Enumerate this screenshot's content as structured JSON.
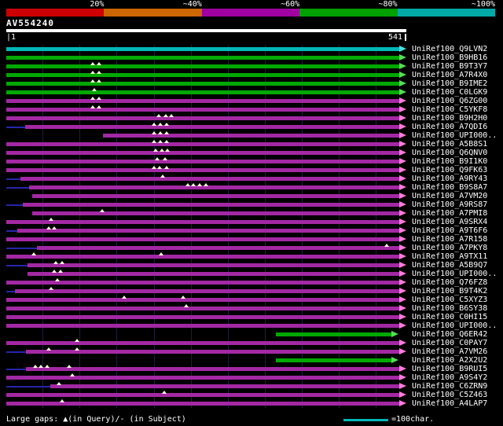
{
  "chart_data": {
    "type": "bar",
    "title": "AV554240",
    "x_range": [
      1,
      541
    ],
    "x_tick_labels": [
      "|1",
      "541"
    ],
    "grid_interval": 50,
    "identity_scale": {
      "labels": [
        "20%",
        "~40%",
        "~60%",
        "~80%",
        "~100%"
      ],
      "colors": [
        "#cc0000",
        "#cc6600",
        "#a000a0",
        "#00a000",
        "#00a8a8"
      ]
    },
    "legend": {
      "gaps": "Large gaps: ▲(in Query)/- (in Subject)",
      "scale_line": "=100char."
    },
    "rows": [
      {
        "label": "UniRef100_Q9LVN2",
        "color": "cyan",
        "start": 1,
        "end": 541,
        "gaps": []
      },
      {
        "label": "UniRef100_B9HB16",
        "color": "green",
        "start": 1,
        "end": 541,
        "gaps": []
      },
      {
        "label": "UniRef100_B9T3Y7",
        "color": "green",
        "start": 1,
        "end": 541,
        "gaps": [
          118,
          126
        ]
      },
      {
        "label": "UniRef100_A7R4X0",
        "color": "green",
        "start": 1,
        "end": 541,
        "gaps": [
          118,
          126
        ]
      },
      {
        "label": "UniRef100_B9IME2",
        "color": "green",
        "start": 1,
        "end": 541,
        "gaps": [
          118,
          126
        ]
      },
      {
        "label": "UniRef100_C0LGK9",
        "color": "green",
        "start": 1,
        "end": 541,
        "gaps": [
          120
        ]
      },
      {
        "label": "UniRef100_Q6ZG00",
        "color": "purple",
        "start": 1,
        "end": 541,
        "gaps": [
          118,
          126
        ]
      },
      {
        "label": "UniRef100_C5YKF8",
        "color": "purple",
        "start": 1,
        "end": 541,
        "gaps": [
          118,
          126
        ]
      },
      {
        "label": "UniRef100_B9H2H0",
        "color": "purple",
        "start": 1,
        "end": 541,
        "gaps": [
          207,
          216,
          224
        ]
      },
      {
        "label": "UniRef100_A7QDI6",
        "color": "purple",
        "start": 26,
        "end": 541,
        "gaps": [
          200,
          209,
          217
        ],
        "line": [
          1,
          26
        ]
      },
      {
        "label": "UniRef100_UPI000..",
        "color": "purple",
        "start": 131,
        "end": 541,
        "gaps": [
          200,
          209,
          217
        ]
      },
      {
        "label": "UniRef100_A5B8S1",
        "color": "purple",
        "start": 1,
        "end": 541,
        "gaps": [
          200,
          209,
          217
        ]
      },
      {
        "label": "UniRef100_Q6QNV0",
        "color": "purple",
        "start": 1,
        "end": 541,
        "gaps": [
          203,
          211,
          219
        ]
      },
      {
        "label": "UniRef100_B9I1K0",
        "color": "purple",
        "start": 1,
        "end": 541,
        "gaps": [
          205,
          215
        ]
      },
      {
        "label": "UniRef100_Q9FK63",
        "color": "purple",
        "start": 1,
        "end": 541,
        "gaps": [
          200,
          208,
          217
        ]
      },
      {
        "label": "UniRef100_A9RY43",
        "color": "purple",
        "start": 20,
        "end": 541,
        "gaps": [
          212
        ],
        "line": [
          1,
          20
        ]
      },
      {
        "label": "UniRef100_B9S8A7",
        "color": "purple",
        "start": 32,
        "end": 541,
        "gaps": [
          246,
          254,
          262,
          270
        ],
        "line": [
          1,
          32
        ]
      },
      {
        "label": "UniRef100_A7VM20",
        "color": "purple",
        "start": 36,
        "end": 541,
        "gaps": []
      },
      {
        "label": "UniRef100_A9RS87",
        "color": "purple",
        "start": 23,
        "end": 541,
        "gaps": [],
        "line": [
          1,
          23
        ]
      },
      {
        "label": "UniRef100_A7PMI8",
        "color": "purple",
        "start": 36,
        "end": 541,
        "gaps": [
          130
        ]
      },
      {
        "label": "UniRef100_A9SRX4",
        "color": "purple",
        "start": 1,
        "end": 541,
        "gaps": [
          62
        ]
      },
      {
        "label": "UniRef100_A9T6F6",
        "color": "purple",
        "start": 16,
        "end": 541,
        "gaps": [
          58,
          66
        ],
        "line": [
          1,
          16
        ]
      },
      {
        "label": "UniRef100_A7R158",
        "color": "purple",
        "start": 1,
        "end": 541,
        "gaps": []
      },
      {
        "label": "UniRef100_A7PKY8",
        "color": "purple",
        "start": 42,
        "end": 541,
        "gaps": [
          514
        ],
        "line": [
          1,
          42
        ]
      },
      {
        "label": "UniRef100_A9TX11",
        "color": "purple",
        "start": 1,
        "end": 541,
        "gaps": [
          38,
          210
        ]
      },
      {
        "label": "UniRef100_A5B9Q7",
        "color": "purple",
        "start": 30,
        "end": 541,
        "gaps": [
          68,
          76
        ],
        "line": [
          1,
          30
        ]
      },
      {
        "label": "UniRef100_UPI000..",
        "color": "purple",
        "start": 30,
        "end": 541,
        "gaps": [
          66,
          74
        ]
      },
      {
        "label": "UniRef100_Q76FZ8",
        "color": "purple",
        "start": 1,
        "end": 541,
        "gaps": [
          70
        ]
      },
      {
        "label": "UniRef100_B9T4K2",
        "color": "purple",
        "start": 13,
        "end": 541,
        "gaps": [
          62
        ],
        "line": [
          1,
          13
        ]
      },
      {
        "label": "UniRef100_C5XYZ3",
        "color": "purple",
        "start": 1,
        "end": 541,
        "gaps": [
          160,
          240
        ]
      },
      {
        "label": "UniRef100_B6SY38",
        "color": "purple",
        "start": 1,
        "end": 541,
        "gaps": [
          244
        ]
      },
      {
        "label": "UniRef100_C0HI15",
        "color": "purple",
        "start": 1,
        "end": 541,
        "gaps": []
      },
      {
        "label": "UniRef100_UPI000..",
        "color": "purple",
        "start": 1,
        "end": 541,
        "gaps": []
      },
      {
        "label": "UniRef100_Q6ER42",
        "color": "green",
        "start": 365,
        "end": 530,
        "gaps": []
      },
      {
        "label": "UniRef100_C0PAY7",
        "color": "purple",
        "start": 1,
        "end": 541,
        "gaps": [
          96
        ]
      },
      {
        "label": "UniRef100_A7VM26",
        "color": "purple",
        "start": 27,
        "end": 541,
        "gaps": [
          58,
          96
        ],
        "line": [
          1,
          27
        ]
      },
      {
        "label": "UniRef100_A2X2U2",
        "color": "green",
        "start": 365,
        "end": 530,
        "gaps": []
      },
      {
        "label": "UniRef100_B9RUI5",
        "color": "purple",
        "start": 27,
        "end": 541,
        "gaps": [
          40,
          48,
          56,
          86
        ],
        "line": [
          1,
          27
        ]
      },
      {
        "label": "UniRef100_A9S4Y2",
        "color": "purple",
        "start": 1,
        "end": 541,
        "gaps": [
          90
        ]
      },
      {
        "label": "UniRef100_C6ZRN9",
        "color": "purple",
        "start": 60,
        "end": 541,
        "gaps": [
          72
        ],
        "line": [
          1,
          60
        ]
      },
      {
        "label": "UniRef100_C5Z463",
        "color": "purple",
        "start": 1,
        "end": 541,
        "gaps": [
          214
        ]
      },
      {
        "label": "UniRef100_A4LAP7",
        "color": "purple",
        "start": 1,
        "end": 541,
        "gaps": [
          76
        ]
      }
    ]
  },
  "colors": {
    "background": "#000000",
    "bar_cyan": "#00b7b7",
    "bar_green": "#00a800",
    "bar_purple": "#a328a3",
    "arrow_cyan": "#44dddd",
    "arrow_green": "#55dd55",
    "arrow_purple": "#ff7ad9",
    "connector_navy": "#2626aa",
    "gap_marker": "#ffffdd",
    "ruler": "#ffffff",
    "text": "#ffffff",
    "scale_legend_line": "#00b7b7"
  }
}
